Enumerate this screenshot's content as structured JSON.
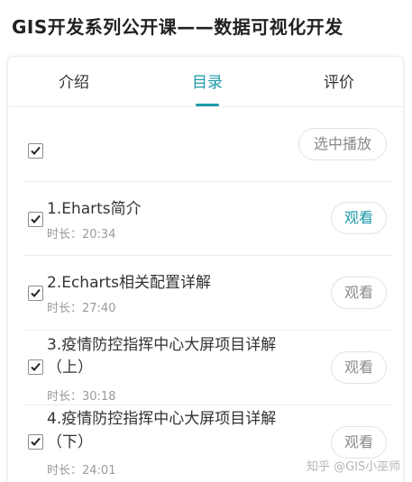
{
  "page": {
    "title": "GIS开发系列公开课——数据可视化开发"
  },
  "tabs": [
    {
      "label": "介绍",
      "active": false
    },
    {
      "label": "目录",
      "active": true
    },
    {
      "label": "评价",
      "active": false
    }
  ],
  "select_all": {
    "checked": true,
    "action_label": "选中播放"
  },
  "lessons": [
    {
      "title": "1.Eharts简介",
      "title_line2": "",
      "duration": "时长：20:34",
      "checked": true,
      "watch_label": "观看",
      "highlighted": true
    },
    {
      "title": "2.Echarts相关配置详解",
      "title_line2": "",
      "duration": "时长：27:40",
      "checked": true,
      "watch_label": "观看",
      "highlighted": false
    },
    {
      "title": "3.疫情防控指挥中心大屏项目详解",
      "title_line2": "（上）",
      "duration": "时长：30:18",
      "checked": true,
      "watch_label": "观看",
      "highlighted": false
    },
    {
      "title": "4.疫情防控指挥中心大屏项目详解",
      "title_line2": "（下）",
      "duration": "时长：24:01",
      "checked": true,
      "watch_label": "观看",
      "highlighted": false
    }
  ],
  "watermark": "知乎 @GIS小巫师",
  "colors": {
    "accent": "#1e9aa8",
    "muted_text": "#9a9a9a",
    "border": "#e3e3e3"
  }
}
